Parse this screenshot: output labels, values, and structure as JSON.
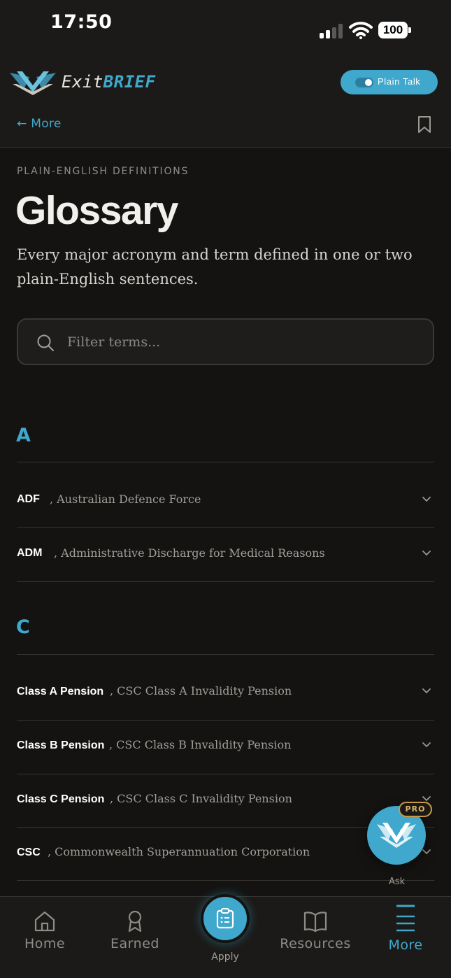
{
  "status_bar": {
    "time": "17:50",
    "battery": "100"
  },
  "app": {
    "brand_part1": "Exit",
    "brand_part2": "BRIEF",
    "plain_talk_label": "Plain Talk"
  },
  "nav": {
    "back_label": "← More"
  },
  "page": {
    "eyebrow": "PLAIN-ENGLISH DEFINITIONS",
    "title": "Glossary",
    "subtitle": "Every major acronym and term defined in one or two plain-English sentences."
  },
  "search": {
    "placeholder": "Filter terms..."
  },
  "glossary": [
    {
      "letter": "A",
      "terms": [
        {
          "term": "ADF",
          "definition": ", Australian Defence Force"
        },
        {
          "term": "ADM",
          "definition": ", Administrative Discharge for Medical Reasons"
        }
      ]
    },
    {
      "letter": "C",
      "terms": [
        {
          "term": "Class A Pension",
          "definition": ", CSC Class A Invalidity Pension"
        },
        {
          "term": "Class B Pension",
          "definition": ", CSC Class B Invalidity Pension"
        },
        {
          "term": "Class C Pension",
          "definition": ", CSC Class C Invalidity Pension"
        },
        {
          "term": "CSC",
          "definition": ", Commonwealth Superannuation Corporation"
        }
      ]
    }
  ],
  "fab": {
    "badge": "PRO",
    "label": "Ask"
  },
  "tabs": [
    {
      "label": "Home",
      "icon": "home-icon"
    },
    {
      "label": "Earned",
      "icon": "award-icon"
    },
    {
      "label": "Apply",
      "icon": "clipboard-icon"
    },
    {
      "label": "Resources",
      "icon": "book-icon"
    },
    {
      "label": "More",
      "icon": "menu-icon"
    }
  ],
  "colors": {
    "accent": "#3fa8cc",
    "background": "#141312",
    "badge_gold": "#c49a4a"
  }
}
